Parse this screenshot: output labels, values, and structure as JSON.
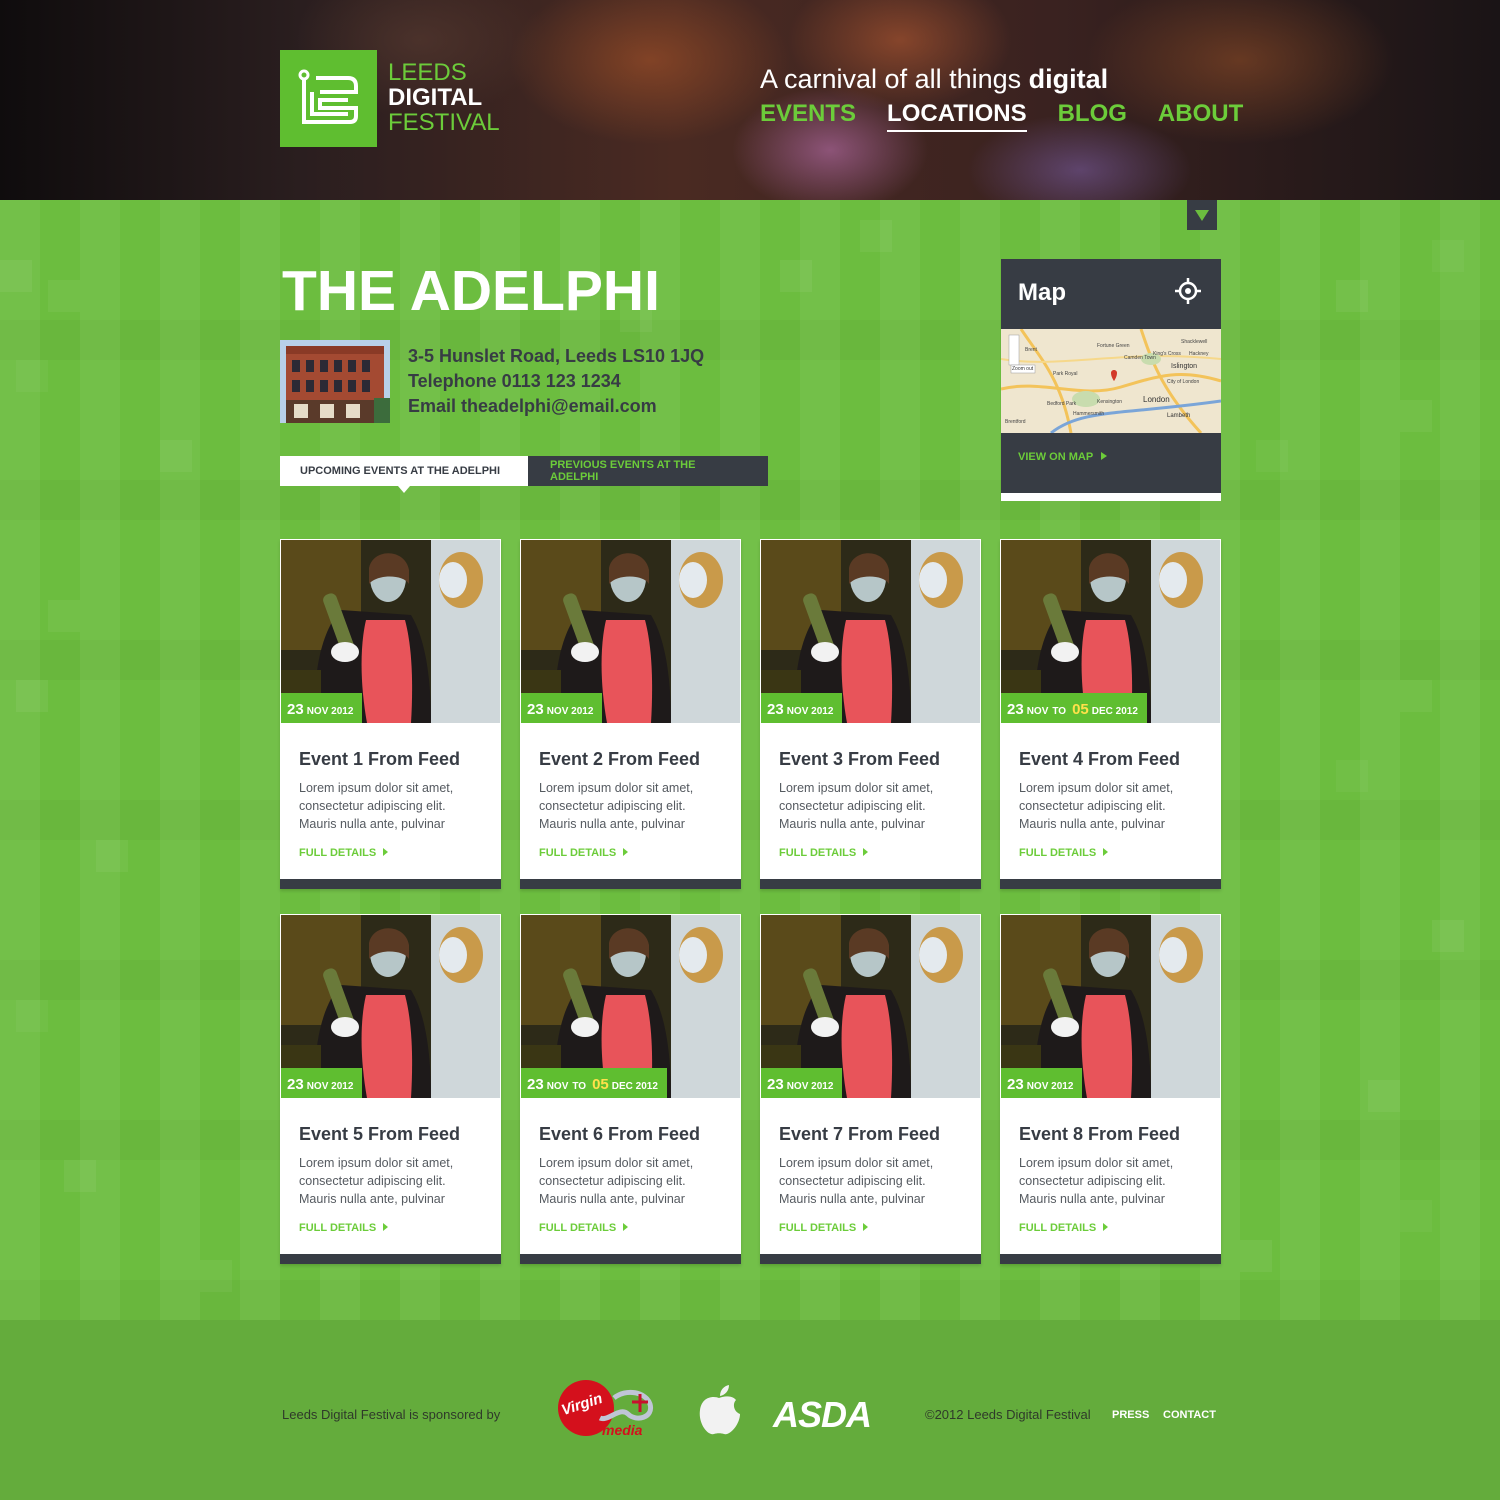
{
  "header": {
    "logo": {
      "line1": "LEEDS",
      "line2": "DIGITAL",
      "line3": "FESTIVAL"
    },
    "tagline_prefix": "A carnival of all things",
    "tagline_bold": "digital",
    "nav": [
      {
        "label": "EVENTS",
        "active": false
      },
      {
        "label": "LOCATIONS",
        "active": true
      },
      {
        "label": "BLOG",
        "active": false
      },
      {
        "label": "ABOUT",
        "active": false
      }
    ]
  },
  "venue": {
    "title": "THE ADELPHI",
    "address": "3-5 Hunslet Road, Leeds LS10 1JQ",
    "telephone": "Telephone 0113 123 1234",
    "email": "Email theadelphi@email.com"
  },
  "tabs": {
    "upcoming": "UPCOMING EVENTS AT THE ADELPHI",
    "previous": "PREVIOUS EVENTS AT THE ADELPHI"
  },
  "map": {
    "title": "Map",
    "link": "VIEW ON MAP",
    "labels": [
      "Brent",
      "Fortune Green",
      "Camden Town",
      "King's Cross",
      "Shacklewell",
      "Islington",
      "Hackney",
      "Park Royal",
      "City of London",
      "London",
      "Kensington",
      "Bedford Park",
      "Hammersmith",
      "Lambeth",
      "Brentford",
      "Zoom out"
    ]
  },
  "events": [
    {
      "title": "Event 1 From Feed",
      "day": "23",
      "month": "NOV 2012",
      "to": "",
      "day2": "",
      "month2": "",
      "desc": "Lorem ipsum dolor sit amet, consectetur adipiscing elit. Mauris nulla ante, pulvinar",
      "more": "FULL DETAILS"
    },
    {
      "title": "Event 2 From Feed",
      "day": "23",
      "month": "NOV 2012",
      "to": "",
      "day2": "",
      "month2": "",
      "desc": "Lorem ipsum dolor sit amet, consectetur adipiscing elit. Mauris nulla ante, pulvinar",
      "more": "FULL DETAILS"
    },
    {
      "title": "Event 3 From Feed",
      "day": "23",
      "month": "NOV 2012",
      "to": "",
      "day2": "",
      "month2": "",
      "desc": "Lorem ipsum dolor sit amet, consectetur adipiscing elit. Mauris nulla ante, pulvinar",
      "more": "FULL DETAILS"
    },
    {
      "title": "Event 4 From Feed",
      "day": "23",
      "month": "NOV",
      "to": "TO",
      "day2": "05",
      "month2": "DEC 2012",
      "desc": "Lorem ipsum dolor sit amet, consectetur adipiscing elit. Mauris nulla ante, pulvinar",
      "more": "FULL DETAILS"
    },
    {
      "title": "Event 5 From Feed",
      "day": "23",
      "month": "NOV 2012",
      "to": "",
      "day2": "",
      "month2": "",
      "desc": "Lorem ipsum dolor sit amet, consectetur adipiscing elit. Mauris nulla ante, pulvinar",
      "more": "FULL DETAILS"
    },
    {
      "title": "Event 6 From Feed",
      "day": "23",
      "month": "NOV",
      "to": "TO",
      "day2": "05",
      "month2": "DEC 2012",
      "desc": "Lorem ipsum dolor sit amet, consectetur adipiscing elit. Mauris nulla ante, pulvinar",
      "more": "FULL DETAILS"
    },
    {
      "title": "Event 7 From Feed",
      "day": "23",
      "month": "NOV 2012",
      "to": "",
      "day2": "",
      "month2": "",
      "desc": "Lorem ipsum dolor sit amet, consectetur adipiscing elit. Mauris nulla ante, pulvinar",
      "more": "FULL DETAILS"
    },
    {
      "title": "Event 8 From Feed",
      "day": "23",
      "month": "NOV 2012",
      "to": "",
      "day2": "",
      "month2": "",
      "desc": "Lorem ipsum dolor sit amet, consectetur adipiscing elit. Mauris nulla ante, pulvinar",
      "more": "FULL DETAILS"
    }
  ],
  "footer": {
    "sponsored": "Leeds Digital Festival is sponsored by",
    "sponsors": {
      "virgin": "Virgin",
      "virgin_sub": "media",
      "apple": "apple-logo",
      "asda": "ASDA"
    },
    "copyright": "©2012 Leeds Digital Festival",
    "press": "PRESS",
    "contact": "CONTACT"
  },
  "colors": {
    "brand_green": "#6cbd3f",
    "dark": "#373c44",
    "accent_yellow": "#ffe14a"
  }
}
